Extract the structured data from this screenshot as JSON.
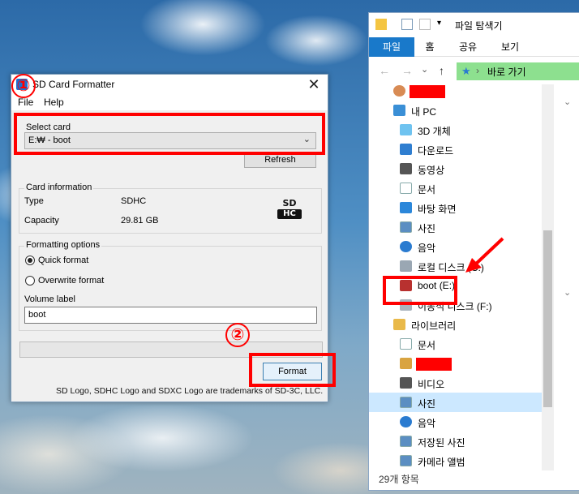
{
  "formatter": {
    "title": "SD Card Formatter",
    "close_label": "✕",
    "menu": {
      "file": "File",
      "help": "Help"
    },
    "select_card": {
      "group_label": "Select card",
      "selected_value": "E:₩ - boot",
      "refresh_label": "Refresh"
    },
    "card_info": {
      "group_label": "Card information",
      "type_label": "Type",
      "type_value": "SDHC",
      "capacity_label": "Capacity",
      "capacity_value": "29.81 GB",
      "logo_top": "SD",
      "logo_bottom": "HC"
    },
    "formatting": {
      "group_label": "Formatting options",
      "quick_label": "Quick format",
      "overwrite_label": "Overwrite format",
      "selected_option": "Quick format",
      "volume_label": "Volume label",
      "volume_value": "boot"
    },
    "progress": 0,
    "format_label": "Format",
    "trademark": "SD Logo, SDHC Logo and SDXC Logo are trademarks of SD-3C, LLC."
  },
  "annotations": {
    "step1": "①",
    "step2": "②",
    "color": "#ff0000"
  },
  "explorer": {
    "title": "파일 탐색기",
    "ribbon_tabs": [
      "파일",
      "홈",
      "공유",
      "보기"
    ],
    "address": "바로 가기",
    "nav": {
      "back": "←",
      "forward": "→",
      "dropdown": "⌄",
      "up": "↑"
    },
    "tree": [
      {
        "label": "",
        "icon": "user-icon",
        "redacted": true
      },
      {
        "label": "내 PC",
        "icon": "pc-icon"
      },
      {
        "label": "3D 개체",
        "icon": "cube-icon"
      },
      {
        "label": "다운로드",
        "icon": "download-icon"
      },
      {
        "label": "동영상",
        "icon": "video-icon"
      },
      {
        "label": "문서",
        "icon": "document-icon"
      },
      {
        "label": "바탕 화면",
        "icon": "desktop-icon"
      },
      {
        "label": "사진",
        "icon": "picture-icon"
      },
      {
        "label": "음악",
        "icon": "music-icon"
      },
      {
        "label": "로컬 디스크 (C:)",
        "icon": "disk-icon"
      },
      {
        "label": "boot (E:)",
        "icon": "sd-card-icon"
      },
      {
        "label": "이동식 디스크 (F:)",
        "icon": "removable-disk-icon"
      },
      {
        "label": "라이브러리",
        "icon": "library-icon"
      },
      {
        "label": "문서",
        "icon": "document-icon"
      },
      {
        "label": "",
        "icon": "shield-icon",
        "redacted": true
      },
      {
        "label": "비디오",
        "icon": "video-icon"
      },
      {
        "label": "사진",
        "icon": "picture-icon",
        "selected": true
      },
      {
        "label": "음악",
        "icon": "music-icon"
      },
      {
        "label": "저장된 사진",
        "icon": "picture-icon"
      },
      {
        "label": "카메라 앨범",
        "icon": "picture-icon"
      }
    ],
    "status": "29개 항목",
    "right_chevron": "⌄"
  }
}
